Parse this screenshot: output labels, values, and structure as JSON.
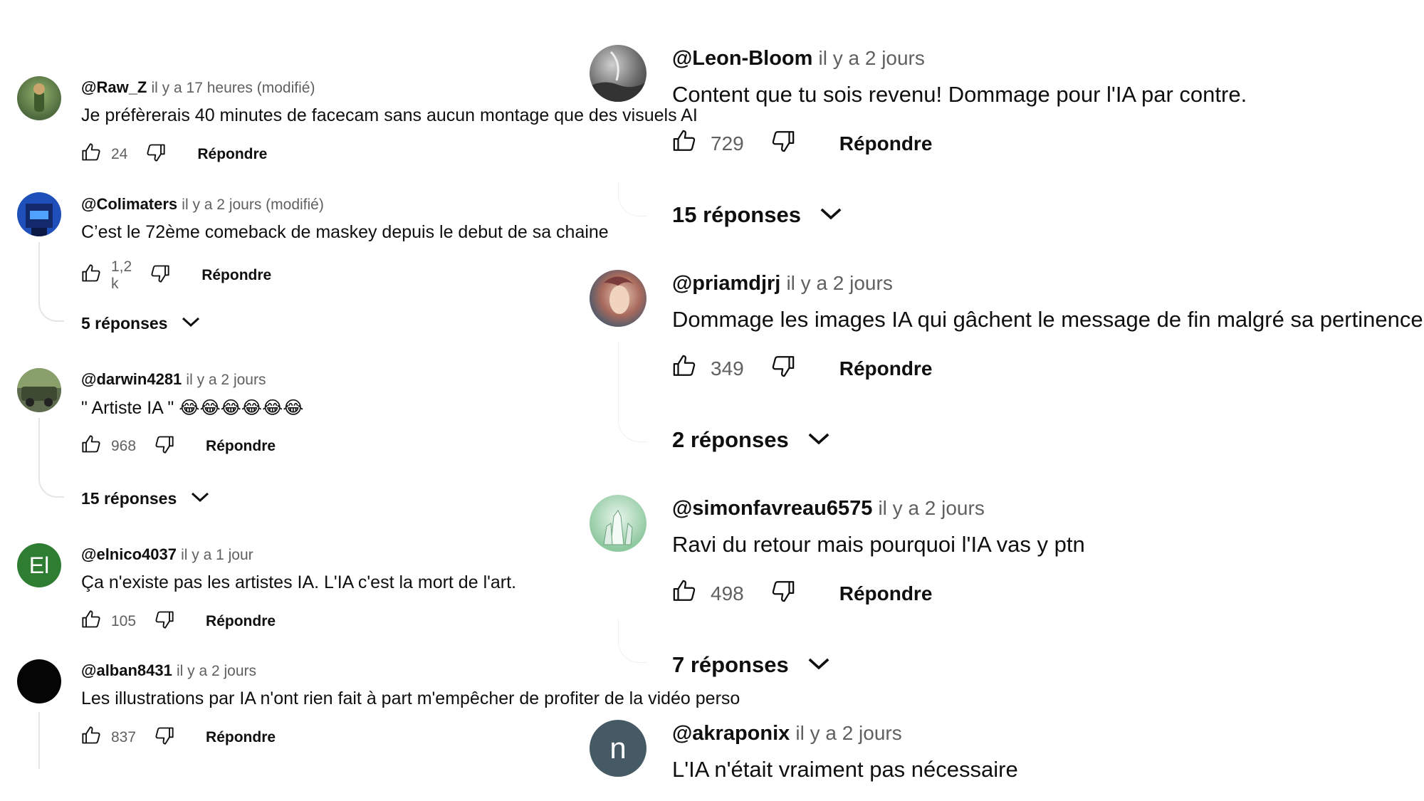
{
  "left_comments": [
    {
      "handle": "@Raw_Z",
      "time": "il y a 17 heures (modifié)",
      "text": "Je préfèrerais 40 minutes de facecam sans aucun montage que des visuels AI",
      "likes": "24",
      "reply": "Répondre",
      "avatar_color": "#6b8a5a"
    },
    {
      "handle": "@Colimaters",
      "time": "il y a 2 jours (modifié)",
      "text": "C’est le 72ème comeback de maskey depuis le debut de sa chaine",
      "likes": "1,2 k",
      "reply": "Répondre",
      "replies": "5 réponses",
      "avatar_color": "#1f4fb8"
    },
    {
      "handle": "@darwin4281",
      "time": "il y a 2 jours",
      "text": "\" Artiste IA \" 😂😂😂😂😂😂",
      "likes": "968",
      "reply": "Répondre",
      "replies": "15 réponses",
      "avatar_color": "#5d6b4e"
    },
    {
      "handle": "@elnico4037",
      "time": "il y a 1 jour",
      "text": "Ça n'existe pas les artistes IA. L'IA c'est la mort de l'art.",
      "likes": "105",
      "reply": "Répondre",
      "avatar_letter": "El",
      "avatar_color": "#2e7d32"
    },
    {
      "handle": "@alban8431",
      "time": "il y a 2 jours",
      "text": "Les illustrations par IA n'ont rien fait à part m'empêcher de profiter de la vidéo perso",
      "likes": "837",
      "reply": "Répondre",
      "avatar_color": "#050505"
    }
  ],
  "right_comments": [
    {
      "handle": "@Leon-Bloom",
      "time": "il y a 2 jours",
      "text": "Content que tu sois revenu! Dommage pour l'IA par contre.",
      "likes": "729",
      "reply": "Répondre",
      "replies": "15 réponses",
      "avatar_color": "#7a7a7a"
    },
    {
      "handle": "@priamdjrj",
      "time": "il y a 2 jours",
      "text": "Dommage les images IA qui gâchent le message de fin malgré sa pertinence",
      "likes": "349",
      "reply": "Répondre",
      "replies": "2 réponses",
      "avatar_color": "#9a5a5a"
    },
    {
      "handle": "@simonfavreau6575",
      "time": "il y a 2 jours",
      "text": "Ravi du retour mais pourquoi l'IA vas y ptn",
      "likes": "498",
      "reply": "Répondre",
      "replies": "7 réponses",
      "avatar_color": "#8fc9a0"
    },
    {
      "handle": "@akraponix",
      "time": "il y a 2 jours",
      "text": "L'IA n'était vraiment pas nécessaire",
      "avatar_letter": "n",
      "avatar_color": "#455a64"
    }
  ]
}
